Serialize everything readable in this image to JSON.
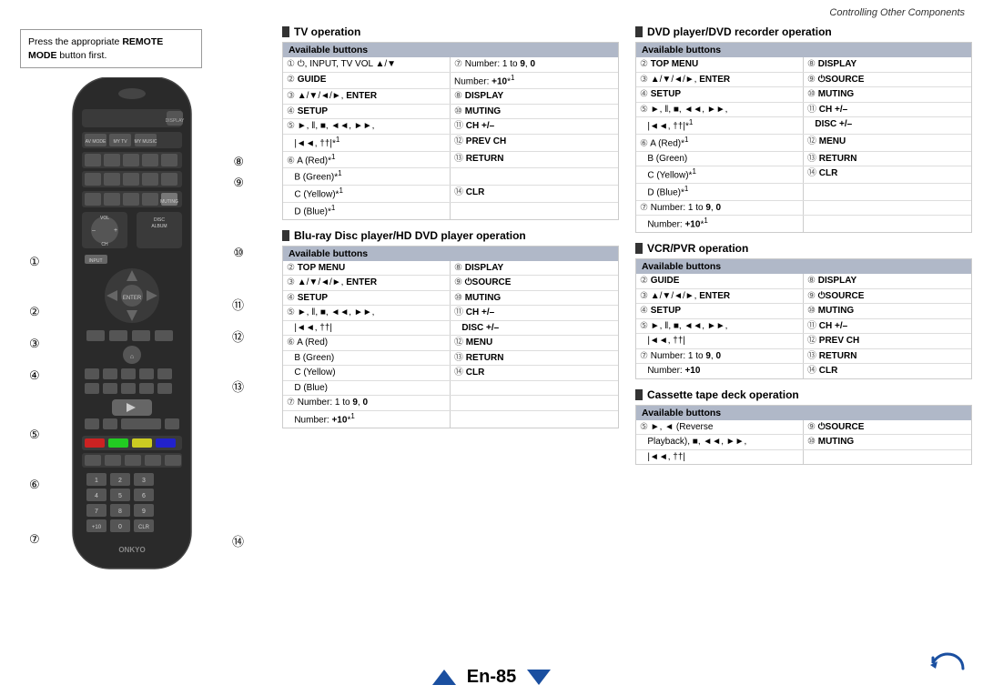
{
  "header": {
    "title": "Controlling Other Components"
  },
  "remote_note": {
    "text1": "Press the appropriate ",
    "bold1": "REMOTE",
    "text2": " MODE button first."
  },
  "callouts": {
    "left": [
      "①",
      "②",
      "③",
      "④",
      "⑤",
      "⑥",
      "⑦"
    ],
    "right": [
      "⑧",
      "⑨",
      "⑩",
      "⑪",
      "⑫",
      "⑬",
      "⑭"
    ]
  },
  "tv_operation": {
    "title": "TV operation",
    "headers": [
      "Available buttons",
      ""
    ],
    "rows": [
      {
        "num": "①",
        "left": "⏻, INPUT, TV VOL ▲/▼",
        "right_num": "⑦",
        "right": "Number: 1 to 9, 0"
      },
      {
        "num": "②",
        "left": "GUIDE",
        "right_num": "",
        "right": "Number: +10*1"
      },
      {
        "num": "③",
        "left": "▲/▼/◄/►, ENTER",
        "right_num": "⑧",
        "right": "DISPLAY"
      },
      {
        "num": "④",
        "left": "SETUP",
        "right_num": "⑩",
        "right": "MUTING"
      },
      {
        "num": "⑤",
        "left": "►, ‖, ■, ◄◄, ►►,",
        "right_num": "⑪",
        "right": "CH +/–"
      },
      {
        "num": "",
        "left": "|◄◄, ►►|*1",
        "right_num": "⑫",
        "right": "PREV CH"
      },
      {
        "num": "⑥",
        "left": "A (Red)*1",
        "right_num": "⑬",
        "right": "RETURN"
      },
      {
        "num": "",
        "left": "B (Green)*1",
        "right_num": "",
        "right": ""
      },
      {
        "num": "",
        "left": "C (Yellow)*1",
        "right_num": "⑭",
        "right": "CLR"
      },
      {
        "num": "",
        "left": "D (Blue)*1",
        "right_num": "",
        "right": ""
      }
    ]
  },
  "bluray_operation": {
    "title": "Blu-ray Disc player/HD DVD player operation",
    "headers": [
      "Available buttons",
      ""
    ],
    "rows": [
      {
        "num": "②",
        "left": "TOP MENU",
        "right_num": "⑧",
        "right": "DISPLAY"
      },
      {
        "num": "③",
        "left": "▲/▼/◄/►, ENTER",
        "right_num": "⑨",
        "right": "⏻SOURCE"
      },
      {
        "num": "④",
        "left": "SETUP",
        "right_num": "⑩",
        "right": "MUTING"
      },
      {
        "num": "⑤",
        "left": "►, ‖, ■, ◄◄, ►►,",
        "right_num": "⑪",
        "right": "CH +/–"
      },
      {
        "num": "",
        "left": "|◄◄, ►►|",
        "right_num": "",
        "right": "DISC +/–"
      },
      {
        "num": "⑥",
        "left": "A (Red)",
        "right_num": "⑫",
        "right": "MENU"
      },
      {
        "num": "",
        "left": "B (Green)",
        "right_num": "⑬",
        "right": "RETURN"
      },
      {
        "num": "",
        "left": "C (Yellow)",
        "right_num": "⑭",
        "right": "CLR"
      },
      {
        "num": "",
        "left": "D (Blue)",
        "right_num": "",
        "right": ""
      },
      {
        "num": "⑦",
        "left": "Number: 1 to 9, 0",
        "right_num": "",
        "right": ""
      },
      {
        "num": "",
        "left": "Number: +10*1",
        "right_num": "",
        "right": ""
      }
    ]
  },
  "dvd_operation": {
    "title": "DVD player/DVD recorder operation",
    "headers": [
      "Available buttons",
      ""
    ],
    "rows": [
      {
        "num": "②",
        "left": "TOP MENU",
        "right_num": "⑧",
        "right": "DISPLAY"
      },
      {
        "num": "③",
        "left": "▲/▼/◄/►, ENTER",
        "right_num": "⑨",
        "right": "⏻SOURCE"
      },
      {
        "num": "④",
        "left": "SETUP",
        "right_num": "⑩",
        "right": "MUTING"
      },
      {
        "num": "⑤",
        "left": "►, ‖, ■, ◄◄, ►►,",
        "right_num": "⑪",
        "right": "CH +/–"
      },
      {
        "num": "",
        "left": "|◄◄, ††|*1",
        "right_num": "",
        "right": "DISC +/–"
      },
      {
        "num": "⑥",
        "left": "A (Red)*1",
        "right_num": "⑫",
        "right": "MENU"
      },
      {
        "num": "",
        "left": "B (Green)",
        "right_num": "⑬",
        "right": "RETURN"
      },
      {
        "num": "",
        "left": "C (Yellow)*1",
        "right_num": "⑭",
        "right": "CLR"
      },
      {
        "num": "",
        "left": "D (Blue)*1",
        "right_num": "",
        "right": ""
      },
      {
        "num": "⑦",
        "left": "Number: 1 to 9, 0",
        "right_num": "",
        "right": ""
      },
      {
        "num": "",
        "left": "Number: +10*1",
        "right_num": "",
        "right": ""
      }
    ]
  },
  "vcr_operation": {
    "title": "VCR/PVR operation",
    "headers": [
      "Available buttons",
      ""
    ],
    "rows": [
      {
        "num": "②",
        "left": "GUIDE",
        "right_num": "⑧",
        "right": "DISPLAY"
      },
      {
        "num": "③",
        "left": "▲/▼/◄/►, ENTER",
        "right_num": "⑨",
        "right": "⏻SOURCE"
      },
      {
        "num": "④",
        "left": "SETUP",
        "right_num": "⑩",
        "right": "MUTING"
      },
      {
        "num": "⑤",
        "left": "►, ‖, ■, ◄◄, ►►,",
        "right_num": "⑪",
        "right": "CH +/–"
      },
      {
        "num": "",
        "left": "|◄◄, ††|",
        "right_num": "⑫",
        "right": "PREV CH"
      },
      {
        "num": "⑦",
        "left": "Number: 1 to 9, 0",
        "right_num": "⑬",
        "right": "RETURN"
      },
      {
        "num": "",
        "left": "Number: +10",
        "right_num": "⑭",
        "right": "CLR"
      }
    ]
  },
  "cassette_operation": {
    "title": "Cassette tape deck operation",
    "headers": [
      "Available buttons",
      ""
    ],
    "rows": [
      {
        "num": "⑤",
        "left": "►, ◄ (Reverse",
        "right_num": "⑨",
        "right": "⏻SOURCE"
      },
      {
        "num": "",
        "left": "Playback), ■, ◄◄, ►►,",
        "right_num": "⑩",
        "right": "MUTING"
      },
      {
        "num": "",
        "left": "|◄◄, ††|",
        "right_num": "",
        "right": ""
      }
    ]
  },
  "footer": {
    "page": "En-85"
  }
}
